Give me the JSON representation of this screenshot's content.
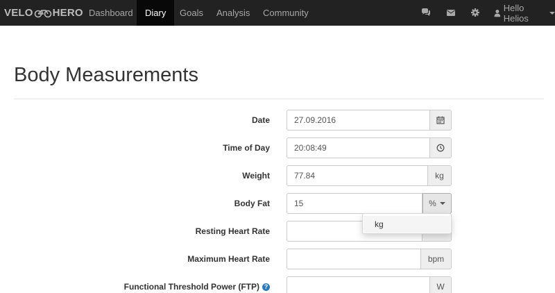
{
  "app": {
    "brand_left": "VELO",
    "brand_right": "HERO",
    "brand_icon": "bicycle-icon"
  },
  "nav": {
    "items": [
      {
        "label": "Dashboard",
        "active": false
      },
      {
        "label": "Diary",
        "active": true
      },
      {
        "label": "Goals",
        "active": false
      },
      {
        "label": "Analysis",
        "active": false
      },
      {
        "label": "Community",
        "active": false
      }
    ],
    "right_icons": [
      "comments-icon",
      "envelope-icon",
      "gear-icon"
    ],
    "user_label": "Hello Helios",
    "user_icon": "user-icon"
  },
  "page": {
    "title": "Body Measurements"
  },
  "form": {
    "date": {
      "label": "Date",
      "value": "27.09.2016",
      "addon_icon": "calendar-icon"
    },
    "time_of_day": {
      "label": "Time of Day",
      "value": "20:08:49",
      "addon_icon": "clock-icon"
    },
    "weight": {
      "label": "Weight",
      "value": "77.84",
      "unit": "kg"
    },
    "body_fat": {
      "label": "Body Fat",
      "value": "15",
      "unit": "%"
    },
    "resting_hr": {
      "label": "Resting Heart Rate",
      "value": ""
    },
    "max_hr": {
      "label": "Maximum Heart Rate",
      "value": "",
      "unit": "bpm"
    },
    "ftp": {
      "label": "Functional Threshold Power (FTP)",
      "value": "",
      "unit": "W",
      "help_icon": "question-circle-icon"
    }
  },
  "dropdown": {
    "options": [
      "kg"
    ]
  },
  "colors": {
    "navbar_bg": "#222222",
    "nav_active_bg": "#080808",
    "help_icon": "#2a7ab8"
  }
}
